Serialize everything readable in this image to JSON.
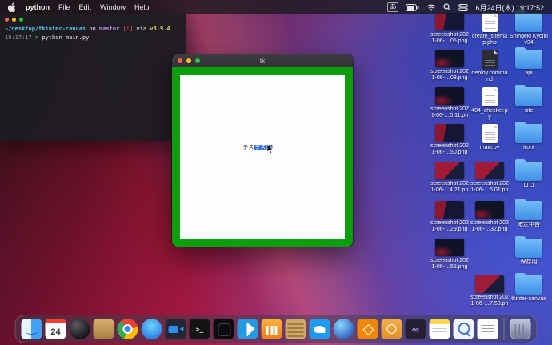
{
  "menu_bar": {
    "app_name": "python",
    "menus": [
      "File",
      "Edit",
      "Window",
      "Help"
    ],
    "ime_label": "あ",
    "clock": "6月24日(木) 19:17:52"
  },
  "terminal": {
    "path": "~/desktop/tkinter-canvas",
    "on_word": "on",
    "branch": "master",
    "dirty_flag": "[!]",
    "via_word": "via",
    "python_version": "v3.9.4",
    "time": "19:17:17",
    "prompt_char": ">",
    "command": "python main.py"
  },
  "tk_window": {
    "title": "tk",
    "canvas_text_plain": "テス",
    "canvas_text_selected": "テスト"
  },
  "desktop": {
    "column_a": [
      {
        "label": "screenshot 2021-06-…05.png",
        "type": "image"
      },
      {
        "label": "screenshot 2021-06-…08.png",
        "type": "image"
      },
      {
        "label": "screenshot 2021-06-…0.11.png",
        "type": "image"
      },
      {
        "label": "screenshot 2021-06-…50.png",
        "type": "image"
      },
      {
        "label": "screenshot 2021-06-…4.21.png",
        "type": "image"
      },
      {
        "label": "screenshot 2021-06-…29.png",
        "type": "image"
      },
      {
        "label": "screenshot 2021-06-…55.png",
        "type": "image"
      }
    ],
    "column_b": [
      {
        "label": "create_sitemap.php",
        "type": "php-file"
      },
      {
        "label": "deploy.command",
        "type": "command-file"
      },
      {
        "label": "404_checker.py",
        "type": "python-file"
      },
      {
        "label": "main.py",
        "type": "python-file"
      },
      {
        "label": "screenshot 2021-06-…6.01.png",
        "type": "image"
      },
      {
        "label": "screenshot 2021-06-…32.png",
        "type": "image"
      },
      {
        "label": "screenshot 2021-06-…7.58.png",
        "type": "image"
      }
    ],
    "column_c": [
      {
        "label": "Shingeki Kyojin v34",
        "type": "folder"
      },
      {
        "label": "api",
        "type": "folder"
      },
      {
        "label": "site",
        "type": "folder"
      },
      {
        "label": "front",
        "type": "folder"
      },
      {
        "label": "ロゴ",
        "type": "folder"
      },
      {
        "label": "確定申告",
        "type": "folder"
      },
      {
        "label": "保存用",
        "type": "folder"
      },
      {
        "label": "tkinter-canvas",
        "type": "folder"
      }
    ]
  },
  "dock": {
    "calendar_day": "24",
    "terminal_glyph": ">_",
    "infinity_glyph": "∞",
    "apps": [
      "finder",
      "calendar",
      "dark-circle-app",
      "tan-app",
      "chrome",
      "blue-globe-app",
      "camera-app",
      "terminal",
      "dark-app",
      "vscode",
      "orange-chart-app",
      "basket-app",
      "twitter",
      "blue-sphere-app",
      "orange-diagram-app",
      "orange-ring-app",
      "infinity-app",
      "notes",
      "preview",
      "textedit",
      "trash"
    ]
  }
}
